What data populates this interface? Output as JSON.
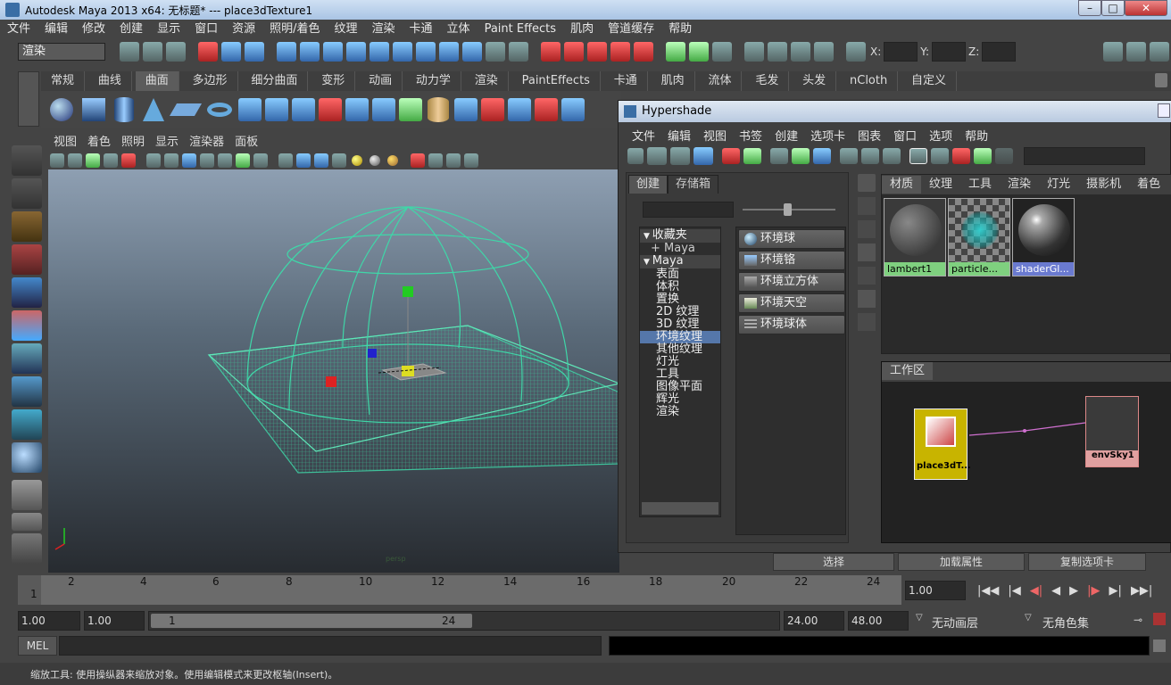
{
  "window": {
    "title": "Autodesk Maya 2013 x64: 无标题*   ---   place3dTexture1",
    "min": "–",
    "max": "□",
    "close": "✕"
  },
  "menubar": [
    "文件",
    "编辑",
    "修改",
    "创建",
    "显示",
    "窗口",
    "资源",
    "照明/着色",
    "纹理",
    "渲染",
    "卡通",
    "立体",
    "Paint Effects",
    "肌肉",
    "管道缓存",
    "帮助"
  ],
  "status": {
    "mode": "渲染",
    "x_label": "X:",
    "y_label": "Y:",
    "z_label": "Z:"
  },
  "shelf_tabs": [
    "常规",
    "曲线",
    "曲面",
    "多边形",
    "细分曲面",
    "变形",
    "动画",
    "动力学",
    "渲染",
    "PaintEffects",
    "卡通",
    "肌肉",
    "流体",
    "毛发",
    "头发",
    "nCloth",
    "自定义"
  ],
  "shelf_active_index": 2,
  "viewport": {
    "menu": [
      "视图",
      "着色",
      "照明",
      "显示",
      "渲染器",
      "面板"
    ],
    "watermark": "persp"
  },
  "hypershade": {
    "title": "Hypershade",
    "menu": [
      "文件",
      "编辑",
      "视图",
      "书签",
      "创建",
      "选项卡",
      "图表",
      "窗口",
      "选项",
      "帮助"
    ],
    "left_tabs": [
      "创建",
      "存储箱"
    ],
    "tree": [
      "收藏夹",
      "Maya",
      "Maya",
      "表面",
      "体积",
      "置换",
      "2D 纹理",
      "3D 纹理",
      "环境纹理",
      "其他纹理",
      "灯光",
      "工具",
      "图像平面",
      "辉光",
      "渲染"
    ],
    "tree_selected": "环境纹理",
    "env_buttons": [
      "环境球",
      "环境铬",
      "环境立方体",
      "环境天空",
      "环境球体"
    ],
    "top_tabs": [
      "材质",
      "纹理",
      "工具",
      "渲染",
      "灯光",
      "摄影机",
      "着色"
    ],
    "materials": [
      "lambert1",
      "particle...",
      "shaderGl..."
    ],
    "workarea_tab": "工作区",
    "node_left": "place3dT...",
    "node_right": "envSky1"
  },
  "bottom_buttons": [
    "选择",
    "加载属性",
    "复制选项卡"
  ],
  "timeline": {
    "start_frame": "1",
    "ticks": [
      "2",
      "4",
      "6",
      "8",
      "10",
      "12",
      "14",
      "16",
      "18",
      "20",
      "22",
      "24"
    ],
    "current": "1.00"
  },
  "range": {
    "start": "1.00",
    "inner_start": "1.00",
    "slider_start": "1",
    "slider_end": "24",
    "end": "24.00",
    "max": "48.00",
    "anim_layer": "无动画层",
    "char_set": "无角色集"
  },
  "cmd": {
    "label": "MEL"
  },
  "help": "缩放工具: 使用操纵器来缩放对象。使用编辑模式来更改枢轴(Insert)。"
}
